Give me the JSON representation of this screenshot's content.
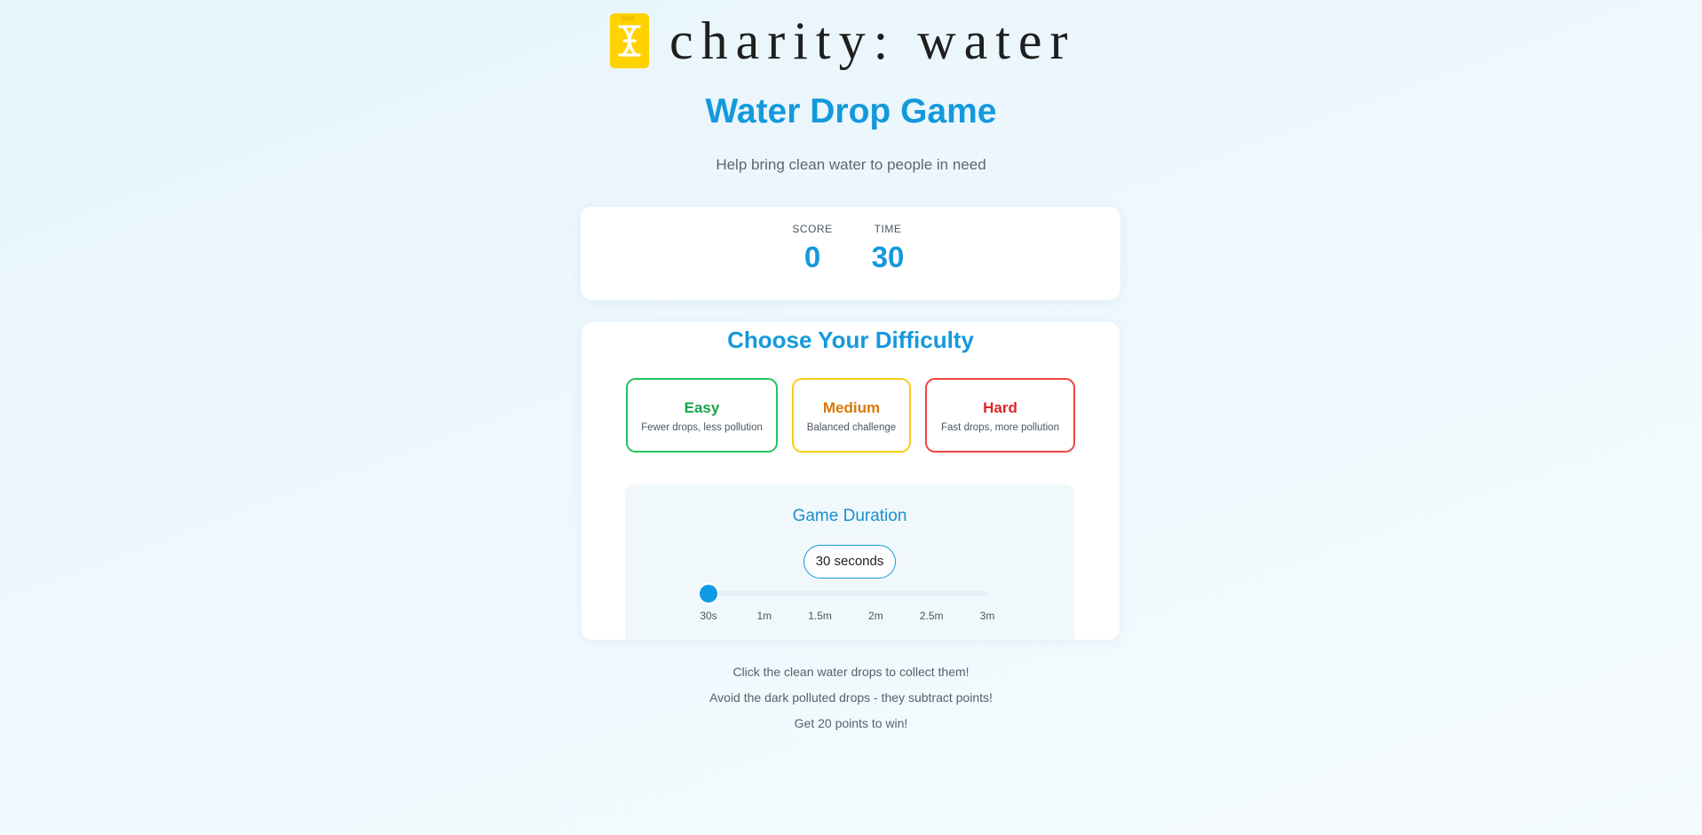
{
  "brand": {
    "logo_text": "charity: water",
    "logo_color": "#FFD200"
  },
  "title": "Water Drop Game",
  "subtitle": "Help bring clean water to people in need",
  "stats": {
    "score_label": "SCORE",
    "score_value": "0",
    "time_label": "TIME",
    "time_value": "30"
  },
  "difficulty": {
    "heading": "Choose Your Difficulty",
    "options": [
      {
        "name": "Easy",
        "description": "Fewer drops, less pollution",
        "color": "#16a34a"
      },
      {
        "name": "Medium",
        "description": "Balanced challenge",
        "color": "#d97706"
      },
      {
        "name": "Hard",
        "description": "Fast drops, more pollution",
        "color": "#dc2626"
      }
    ]
  },
  "duration": {
    "heading": "Game Duration",
    "value_label": "30 seconds",
    "selected_index": 0,
    "ticks": [
      "30s",
      "1m",
      "1.5m",
      "2m",
      "2.5m",
      "3m"
    ]
  },
  "instructions": [
    "Click the clean water drops to collect them!",
    "Avoid the dark polluted drops - they subtract points!",
    "Get 20 points to win!"
  ],
  "colors": {
    "accent": "#1499dc",
    "easy_border": "#22c55e",
    "medium_border": "#facc15",
    "hard_border": "#ef4444"
  }
}
